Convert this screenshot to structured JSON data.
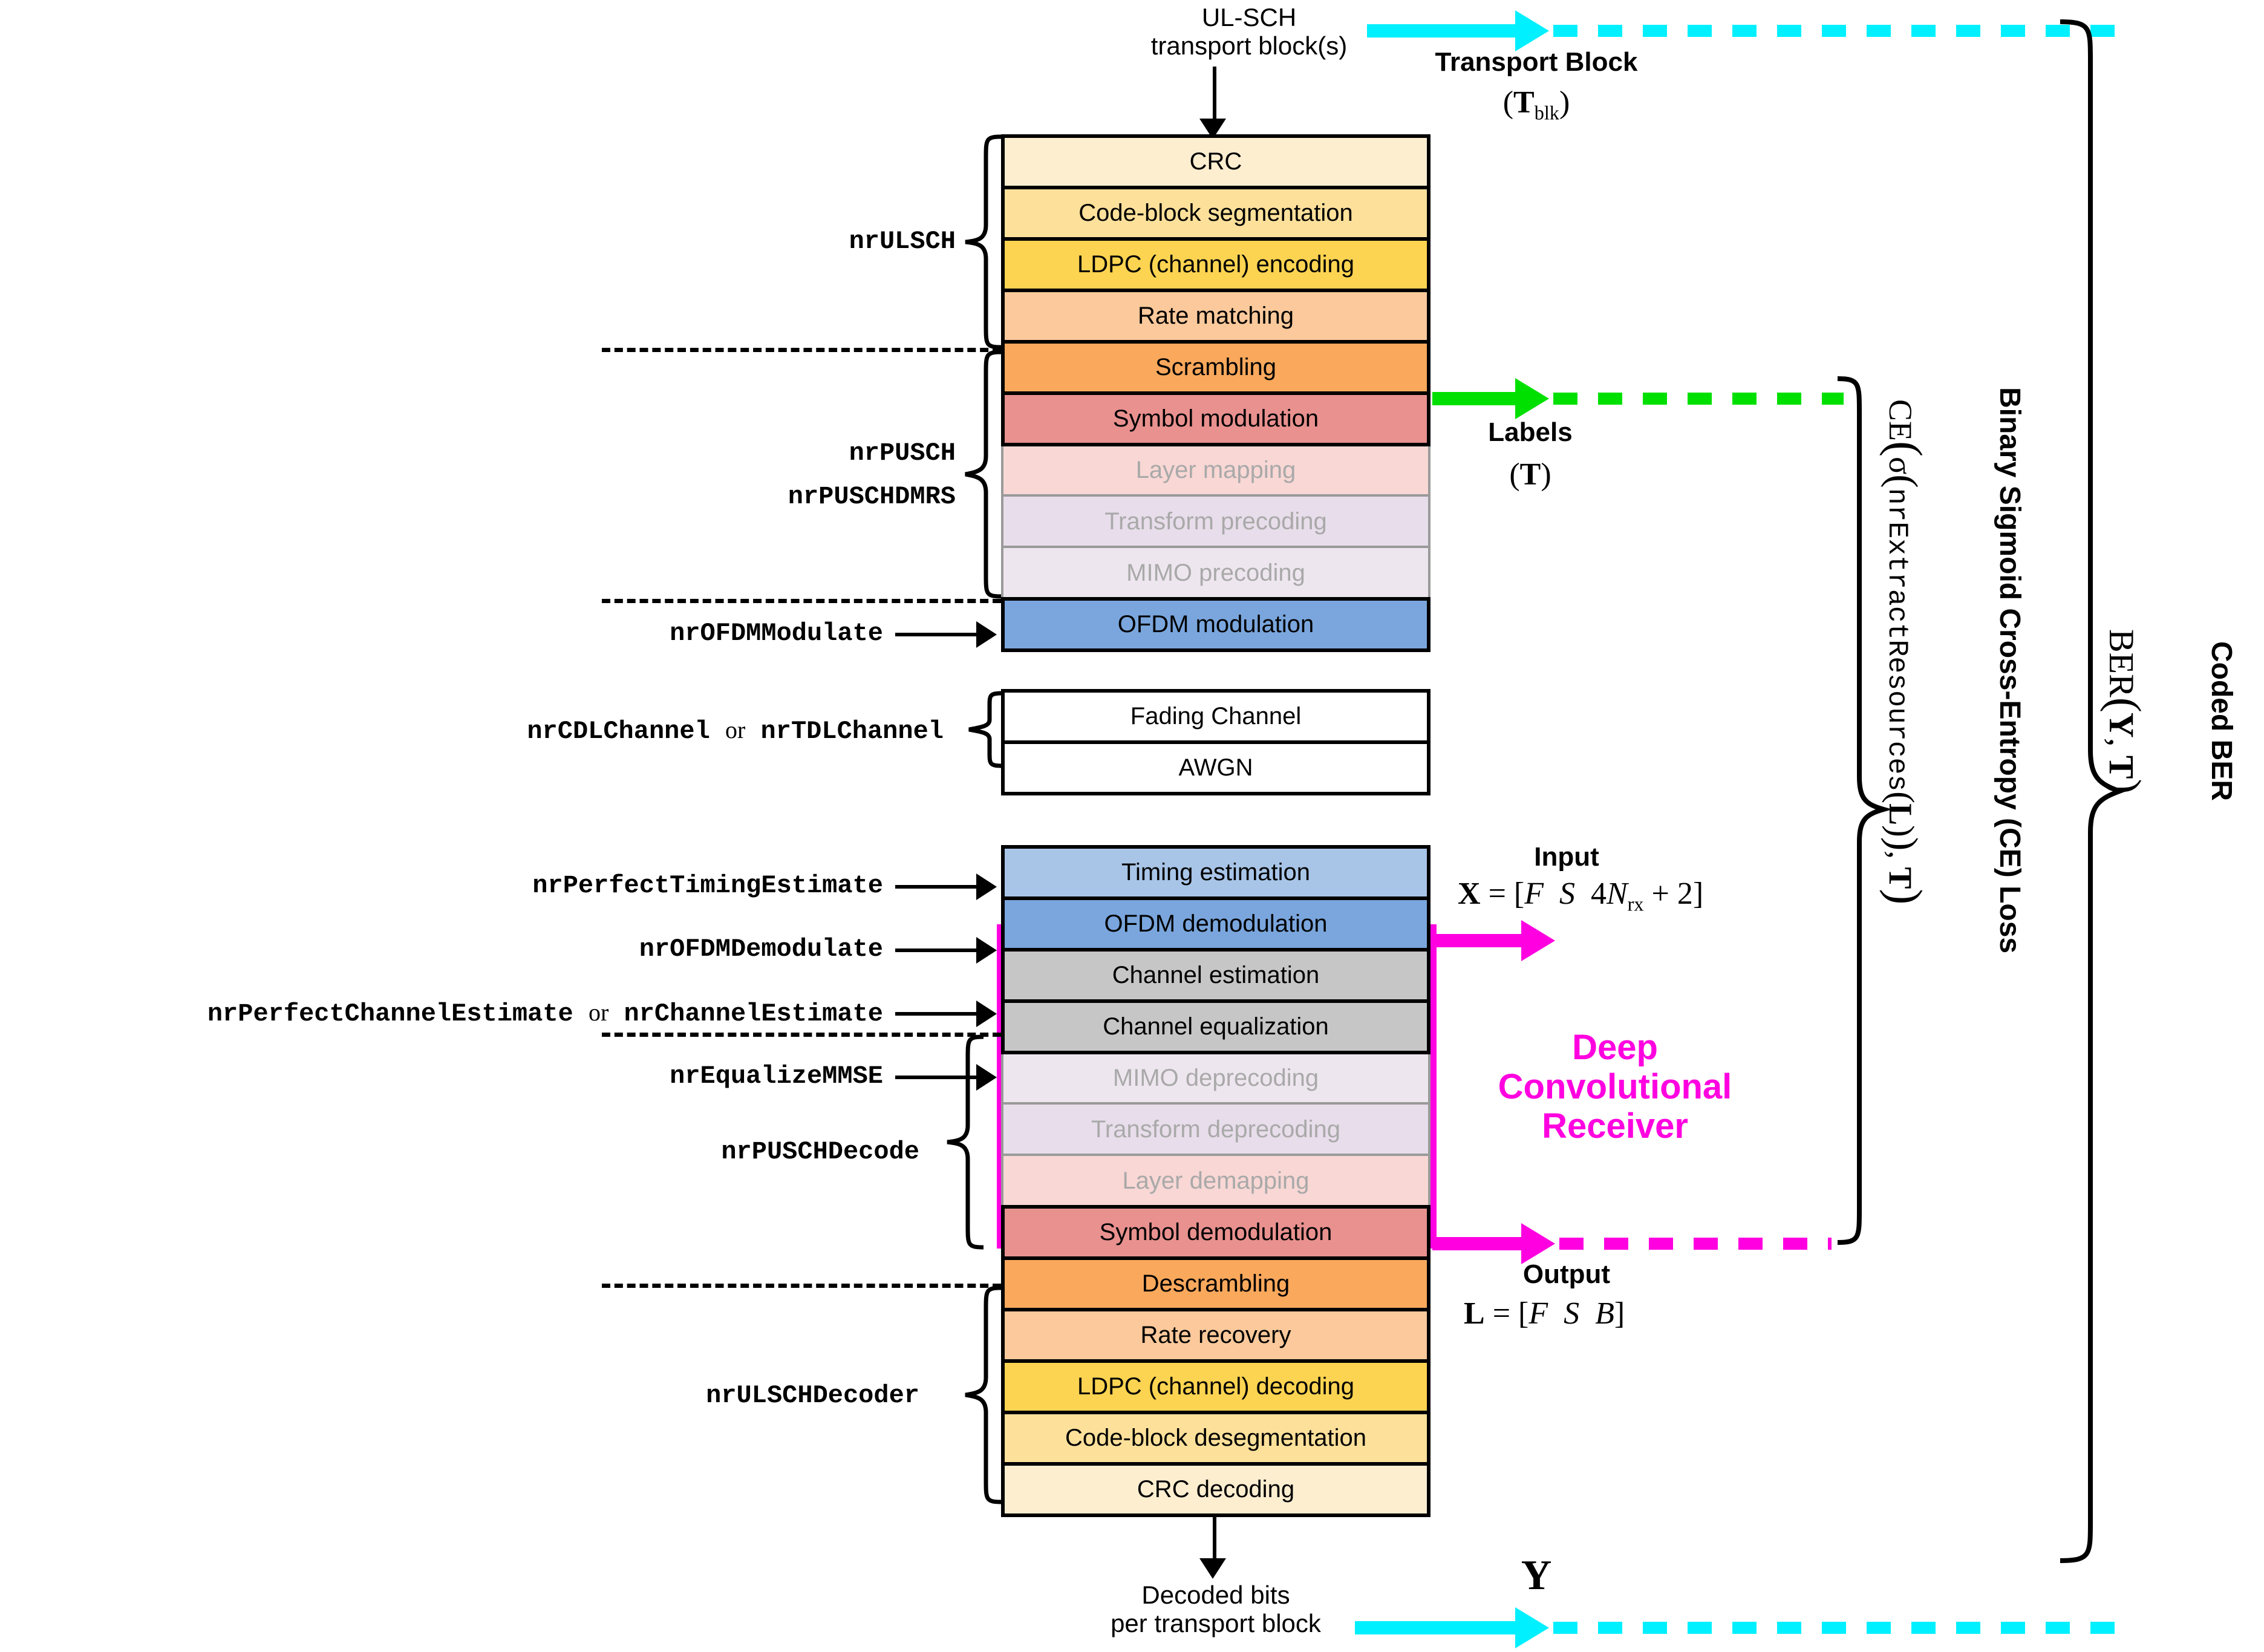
{
  "diagram": {
    "title": "5G NR PUSCH link-level simulation chain with Deep Convolutional Receiver"
  },
  "colors": {
    "cyan": "#00f0ff",
    "green": "#00e000",
    "magenta": "#ff00e0",
    "black": "#000000",
    "dim_text": "#a9a9a9",
    "dim_border": "#9a9a9a"
  },
  "top": {
    "source_label_line1": "UL-SCH",
    "source_label_line2": "transport block(s)",
    "transport_block_label": "Transport Block",
    "transport_block_symbol": "(T",
    "transport_block_symbol_sub": "blk",
    "transport_block_symbol_close": ")"
  },
  "tx_blocks": [
    {
      "label": "CRC",
      "color": "#fdeed0",
      "dim": false
    },
    {
      "label": "Code-block segmentation",
      "color": "#fde09a",
      "dim": false
    },
    {
      "label": "LDPC (channel) encoding",
      "color": "#fdd451",
      "dim": false
    },
    {
      "label": "Rate matching",
      "color": "#fbc99b",
      "dim": false
    },
    {
      "label": "Scrambling",
      "color": "#f9a85c",
      "dim": false
    },
    {
      "label": "Symbol modulation",
      "color": "#e8918f",
      "dim": false
    },
    {
      "label": "Layer mapping",
      "color": "#f8d7d5",
      "dim": true
    },
    {
      "label": "Transform precoding",
      "color": "#e8ddea",
      "dim": true
    },
    {
      "label": "MIMO precoding",
      "color": "#eee6ef",
      "dim": true
    },
    {
      "label": "OFDM modulation",
      "color": "#7aa6dd",
      "dim": false
    }
  ],
  "channel_blocks": [
    {
      "label": "Fading Channel",
      "color": "#ffffff",
      "dim": false
    },
    {
      "label": "AWGN",
      "color": "#ffffff",
      "dim": false
    }
  ],
  "rx_blocks": [
    {
      "label": "Timing estimation",
      "color": "#a8c5e8",
      "dim": false
    },
    {
      "label": "OFDM demodulation",
      "color": "#7aa6dd",
      "dim": false
    },
    {
      "label": "Channel estimation",
      "color": "#c6c6c6",
      "dim": false
    },
    {
      "label": "Channel equalization",
      "color": "#c6c6c6",
      "dim": false
    },
    {
      "label": "MIMO deprecoding",
      "color": "#eee6ef",
      "dim": true
    },
    {
      "label": "Transform deprecoding",
      "color": "#e8ddea",
      "dim": true
    },
    {
      "label": "Layer demapping",
      "color": "#f8d7d5",
      "dim": true
    },
    {
      "label": "Symbol demodulation",
      "color": "#e8918f",
      "dim": false
    },
    {
      "label": "Descrambling",
      "color": "#f9a85c",
      "dim": false
    },
    {
      "label": "Rate recovery",
      "color": "#fbc99b",
      "dim": false
    },
    {
      "label": "LDPC (channel) decoding",
      "color": "#fdd451",
      "dim": false
    },
    {
      "label": "Code-block desegmentation",
      "color": "#fde09a",
      "dim": false
    },
    {
      "label": "CRC decoding",
      "color": "#fdeed0",
      "dim": false
    }
  ],
  "function_labels": {
    "nrULSCH": "nrULSCH",
    "nrPUSCH": "nrPUSCH",
    "nrPUSCHDMRS": "nrPUSCHDMRS",
    "nrOFDMModulate": "nrOFDMModulate",
    "nrCDLChannel": "nrCDLChannel",
    "or1": "or",
    "nrTDLChannel": "nrTDLChannel",
    "nrPerfectTimingEstimate": "nrPerfectTimingEstimate",
    "nrOFDMDemodulate": "nrOFDMDemodulate",
    "nrPerfectChannelEstimate": "nrPerfectChannelEstimate",
    "or2": "or",
    "nrChannelEstimate": "nrChannelEstimate",
    "nrEqualizeMMSE": "nrEqualizeMMSE",
    "nrPUSCHDecode": "nrPUSCHDecode",
    "nrULSCHDecoder": "nrULSCHDecoder"
  },
  "annotations": {
    "labels_title": "Labels",
    "labels_symbol": "(T)",
    "input_title": "Input",
    "input_formula_lhs": "X",
    "input_formula": " = [F  S  4N",
    "input_formula_sub": "rx",
    "input_formula_tail": " + 2]",
    "output_title": "Output",
    "output_formula_lhs": "L",
    "output_formula": " = [F  S  B]",
    "dcr_title_line1": "Deep",
    "dcr_title_line2": "Convolutional",
    "dcr_title_line3": "Receiver",
    "loss_name": "Binary Sigmoid Cross-Entropy (CE) Loss",
    "loss_formula_head": "CE",
    "loss_formula_body": "σ(nrExtractResources(L)), T",
    "ber_name": "Coded BER",
    "ber_formula": "BER(Y, T)",
    "decoded_line1": "Decoded bits",
    "decoded_line2": "per transport block",
    "y_symbol": "Y"
  }
}
